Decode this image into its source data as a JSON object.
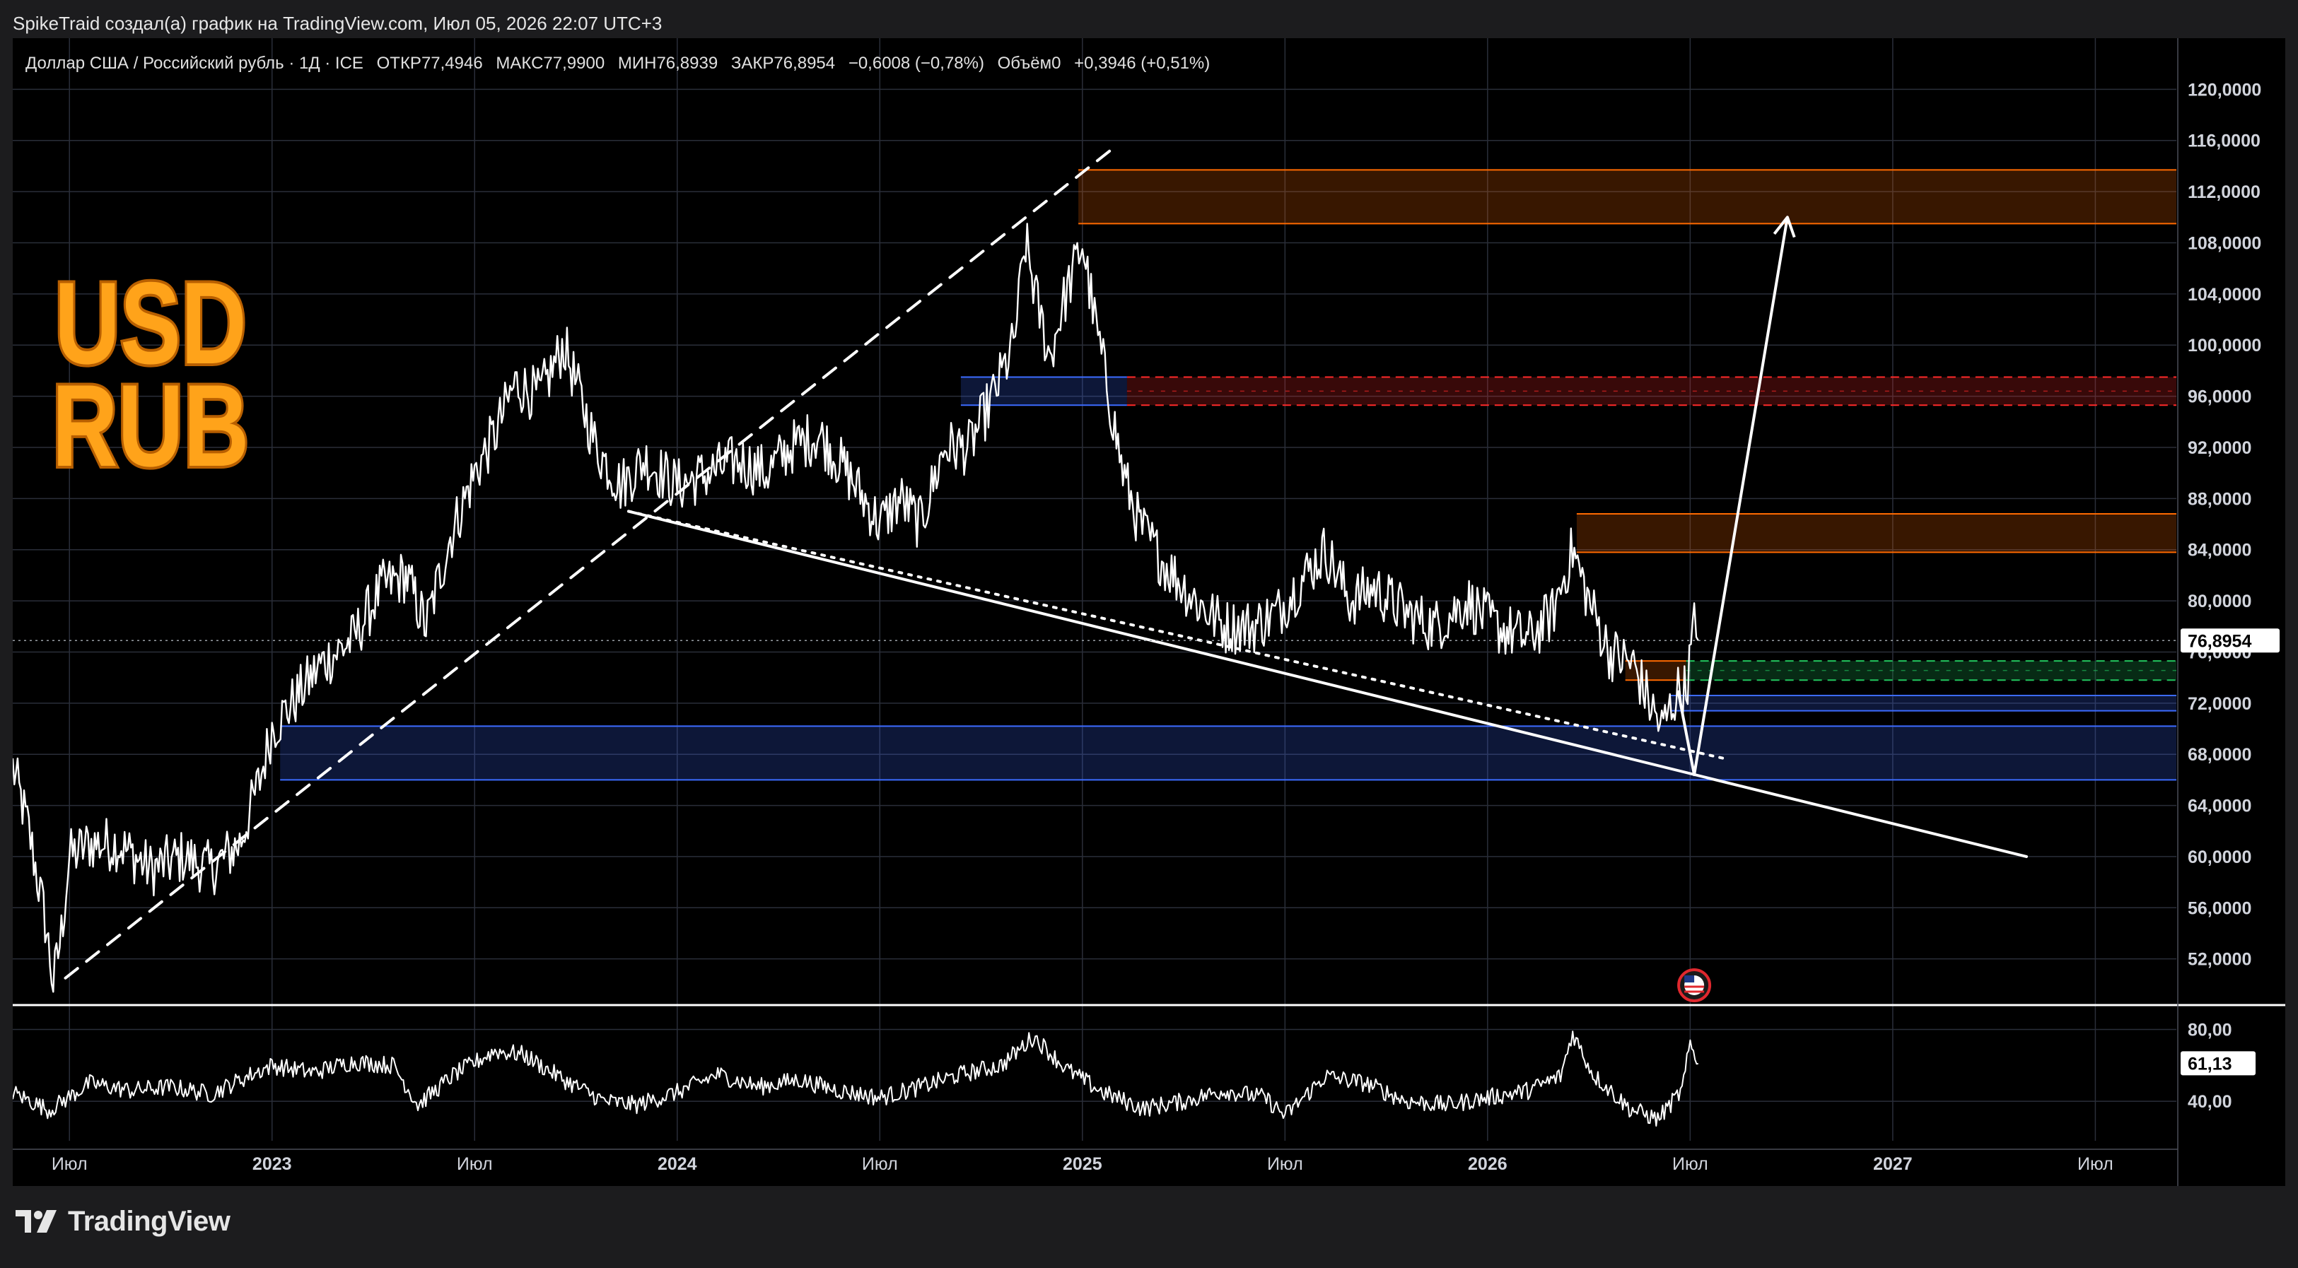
{
  "header": {
    "attribution": "SpikeTraid создал(а) график на TradingView.com, Июл 05, 2026 22:07 UTC+3"
  },
  "legend": {
    "symbol": "Доллар США / Российский рубль · 1Д · ICE",
    "open_label": "ОТКР",
    "open": "77,4946",
    "high_label": "МАКС",
    "high": "77,9900",
    "low_label": "МИН",
    "low": "76,8939",
    "close_label": "ЗАКР",
    "close": "76,8954",
    "change": "−0,6008 (−0,78%)",
    "volume_label": "Объём",
    "volume": "0",
    "extra": "+0,3946 (+0,51%)"
  },
  "logo_badge": {
    "line1": "USD",
    "line2": "RUB"
  },
  "footer": {
    "brand": "TradingView"
  },
  "chart_data": {
    "type": "line",
    "symbol": "USD/RUB",
    "timeframe": "1Д",
    "price_axis": {
      "ticks": [
        52,
        56,
        60,
        64,
        68,
        72,
        76,
        80,
        84,
        88,
        92,
        96,
        100,
        104,
        108,
        112,
        116,
        120
      ],
      "tick_labels": [
        "52,0000",
        "56,0000",
        "60,0000",
        "64,0000",
        "68,0000",
        "72,0000",
        "76,0000",
        "80,0000",
        "84,0000",
        "88,0000",
        "92,0000",
        "96,0000",
        "100,0000",
        "104,0000",
        "108,0000",
        "112,0000",
        "116,0000",
        "120,0000"
      ],
      "ylim": [
        48.5,
        124
      ],
      "last_price": 76.8954,
      "last_price_label": "76,8954"
    },
    "time_axis": {
      "ticks": [
        {
          "label": "Июл",
          "t": 2022.5,
          "bold": false
        },
        {
          "label": "2023",
          "t": 2023.0,
          "bold": true
        },
        {
          "label": "Июл",
          "t": 2023.5,
          "bold": false
        },
        {
          "label": "2024",
          "t": 2024.0,
          "bold": true
        },
        {
          "label": "Июл",
          "t": 2024.5,
          "bold": false
        },
        {
          "label": "2025",
          "t": 2025.0,
          "bold": true
        },
        {
          "label": "Июл",
          "t": 2025.5,
          "bold": false
        },
        {
          "label": "2026",
          "t": 2026.0,
          "bold": true
        },
        {
          "label": "Июл",
          "t": 2026.5,
          "bold": false
        },
        {
          "label": "2027",
          "t": 2027.0,
          "bold": true
        },
        {
          "label": "Июл",
          "t": 2027.5,
          "bold": false
        }
      ],
      "xlim": [
        2022.36,
        2027.7
      ]
    },
    "price_series": {
      "name": "USD/RUB",
      "color": "#ffffff",
      "anchors": [
        [
          2022.36,
          67
        ],
        [
          2022.4,
          62
        ],
        [
          2022.44,
          55
        ],
        [
          2022.46,
          50
        ],
        [
          2022.48,
          54
        ],
        [
          2022.5,
          60
        ],
        [
          2022.55,
          61
        ],
        [
          2022.62,
          61
        ],
        [
          2022.7,
          59
        ],
        [
          2022.78,
          60
        ],
        [
          2022.85,
          59
        ],
        [
          2022.92,
          61
        ],
        [
          2022.97,
          66
        ],
        [
          2023.0,
          70
        ],
        [
          2023.05,
          72
        ],
        [
          2023.12,
          75
        ],
        [
          2023.2,
          77
        ],
        [
          2023.27,
          81
        ],
        [
          2023.33,
          82
        ],
        [
          2023.38,
          78
        ],
        [
          2023.44,
          85
        ],
        [
          2023.5,
          90
        ],
        [
          2023.55,
          93
        ],
        [
          2023.6,
          97
        ],
        [
          2023.66,
          96
        ],
        [
          2023.72,
          100
        ],
        [
          2023.76,
          96
        ],
        [
          2023.8,
          92
        ],
        [
          2023.86,
          89
        ],
        [
          2023.92,
          91
        ],
        [
          2024.0,
          89
        ],
        [
          2024.08,
          90
        ],
        [
          2024.15,
          91
        ],
        [
          2024.22,
          90
        ],
        [
          2024.28,
          92
        ],
        [
          2024.35,
          93
        ],
        [
          2024.42,
          90
        ],
        [
          2024.5,
          86
        ],
        [
          2024.55,
          88
        ],
        [
          2024.6,
          86
        ],
        [
          2024.66,
          92
        ],
        [
          2024.72,
          92
        ],
        [
          2024.78,
          96
        ],
        [
          2024.83,
          100
        ],
        [
          2024.86,
          108
        ],
        [
          2024.89,
          103
        ],
        [
          2024.92,
          99
        ],
        [
          2024.95,
          103
        ],
        [
          2025.0,
          108
        ],
        [
          2025.03,
          102
        ],
        [
          2025.06,
          97
        ],
        [
          2025.1,
          90
        ],
        [
          2025.14,
          86
        ],
        [
          2025.2,
          83
        ],
        [
          2025.28,
          80
        ],
        [
          2025.35,
          78
        ],
        [
          2025.42,
          78
        ],
        [
          2025.48,
          79
        ],
        [
          2025.55,
          82
        ],
        [
          2025.6,
          84
        ],
        [
          2025.66,
          80
        ],
        [
          2025.72,
          81
        ],
        [
          2025.8,
          79
        ],
        [
          2025.87,
          78
        ],
        [
          2025.95,
          80
        ],
        [
          2026.02,
          78
        ],
        [
          2026.1,
          77
        ],
        [
          2026.16,
          79
        ],
        [
          2026.21,
          84
        ],
        [
          2026.25,
          80
        ],
        [
          2026.3,
          76
        ],
        [
          2026.36,
          75
        ],
        [
          2026.4,
          72
        ],
        [
          2026.43,
          70
        ],
        [
          2026.47,
          73
        ],
        [
          2026.49,
          73
        ],
        [
          2026.51,
          78
        ],
        [
          2026.52,
          76.9
        ]
      ]
    },
    "oscillator": {
      "value_label": "61,13",
      "ticks": [
        40,
        80
      ],
      "tick_labels": [
        "40,00",
        "80,00"
      ],
      "ylim": [
        18,
        92
      ],
      "anchors": [
        [
          2022.36,
          45
        ],
        [
          2022.45,
          35
        ],
        [
          2022.55,
          50
        ],
        [
          2022.65,
          46
        ],
        [
          2022.75,
          48
        ],
        [
          2022.85,
          44
        ],
        [
          2022.95,
          55
        ],
        [
          2023.0,
          60
        ],
        [
          2023.1,
          56
        ],
        [
          2023.2,
          62
        ],
        [
          2023.3,
          60
        ],
        [
          2023.36,
          38
        ],
        [
          2023.45,
          55
        ],
        [
          2023.55,
          68
        ],
        [
          2023.62,
          66
        ],
        [
          2023.72,
          52
        ],
        [
          2023.82,
          40
        ],
        [
          2023.9,
          38
        ],
        [
          2024.0,
          45
        ],
        [
          2024.1,
          55
        ],
        [
          2024.2,
          48
        ],
        [
          2024.3,
          52
        ],
        [
          2024.4,
          46
        ],
        [
          2024.5,
          42
        ],
        [
          2024.6,
          48
        ],
        [
          2024.7,
          55
        ],
        [
          2024.8,
          60
        ],
        [
          2024.88,
          76
        ],
        [
          2024.96,
          58
        ],
        [
          2025.05,
          45
        ],
        [
          2025.15,
          36
        ],
        [
          2025.25,
          40
        ],
        [
          2025.35,
          46
        ],
        [
          2025.45,
          42
        ],
        [
          2025.5,
          32
        ],
        [
          2025.6,
          54
        ],
        [
          2025.7,
          50
        ],
        [
          2025.8,
          40
        ],
        [
          2025.9,
          38
        ],
        [
          2026.0,
          42
        ],
        [
          2026.1,
          46
        ],
        [
          2026.18,
          54
        ],
        [
          2026.21,
          78
        ],
        [
          2026.26,
          55
        ],
        [
          2026.35,
          36
        ],
        [
          2026.42,
          30
        ],
        [
          2026.48,
          46
        ],
        [
          2026.5,
          72
        ],
        [
          2026.52,
          61
        ]
      ]
    },
    "zones": [
      {
        "t0": 2024.99,
        "t1": 2027.7,
        "low": 109.5,
        "high": 113.7,
        "color": "#ff6a00",
        "style": "solid"
      },
      {
        "t0": 2025.11,
        "t1": 2027.7,
        "low": 95.3,
        "high": 97.5,
        "color": "#ff2a2a",
        "style": "dashed"
      },
      {
        "t0": 2024.7,
        "t1": 2025.11,
        "low": 95.3,
        "high": 97.5,
        "color": "#3c6bff",
        "style": "solid"
      },
      {
        "t0": 2026.22,
        "t1": 2027.7,
        "low": 83.8,
        "high": 86.8,
        "color": "#ff6a00",
        "style": "solid"
      },
      {
        "t0": 2026.34,
        "t1": 2026.49,
        "low": 73.8,
        "high": 75.3,
        "color": "#ff6a00",
        "style": "solid"
      },
      {
        "t0": 2026.49,
        "t1": 2027.7,
        "low": 73.8,
        "high": 75.3,
        "color": "#22c55e",
        "style": "dashed"
      },
      {
        "t0": 2026.45,
        "t1": 2027.7,
        "low": 71.4,
        "high": 72.6,
        "color": "#3c6bff",
        "style": "solid"
      },
      {
        "t0": 2023.02,
        "t1": 2027.7,
        "low": 66.0,
        "high": 70.2,
        "color": "#3c6bff",
        "style": "solid"
      }
    ],
    "trendlines": [
      {
        "from": [
          2022.49,
          50.5
        ],
        "to": [
          2025.08,
          115.5
        ],
        "style": "dashed"
      },
      {
        "from": [
          2023.88,
          87.0
        ],
        "to": [
          2027.33,
          60.0
        ],
        "style": "solid"
      },
      {
        "from": [
          2023.88,
          87.0
        ],
        "to": [
          2026.58,
          67.7
        ],
        "style": "dotted"
      }
    ],
    "projection": [
      [
        2026.47,
        73.0
      ],
      [
        2026.51,
        66.4
      ],
      [
        2026.74,
        110.0
      ]
    ],
    "event_marker": {
      "t": 2026.51,
      "icon": "us-flag-icon"
    }
  }
}
